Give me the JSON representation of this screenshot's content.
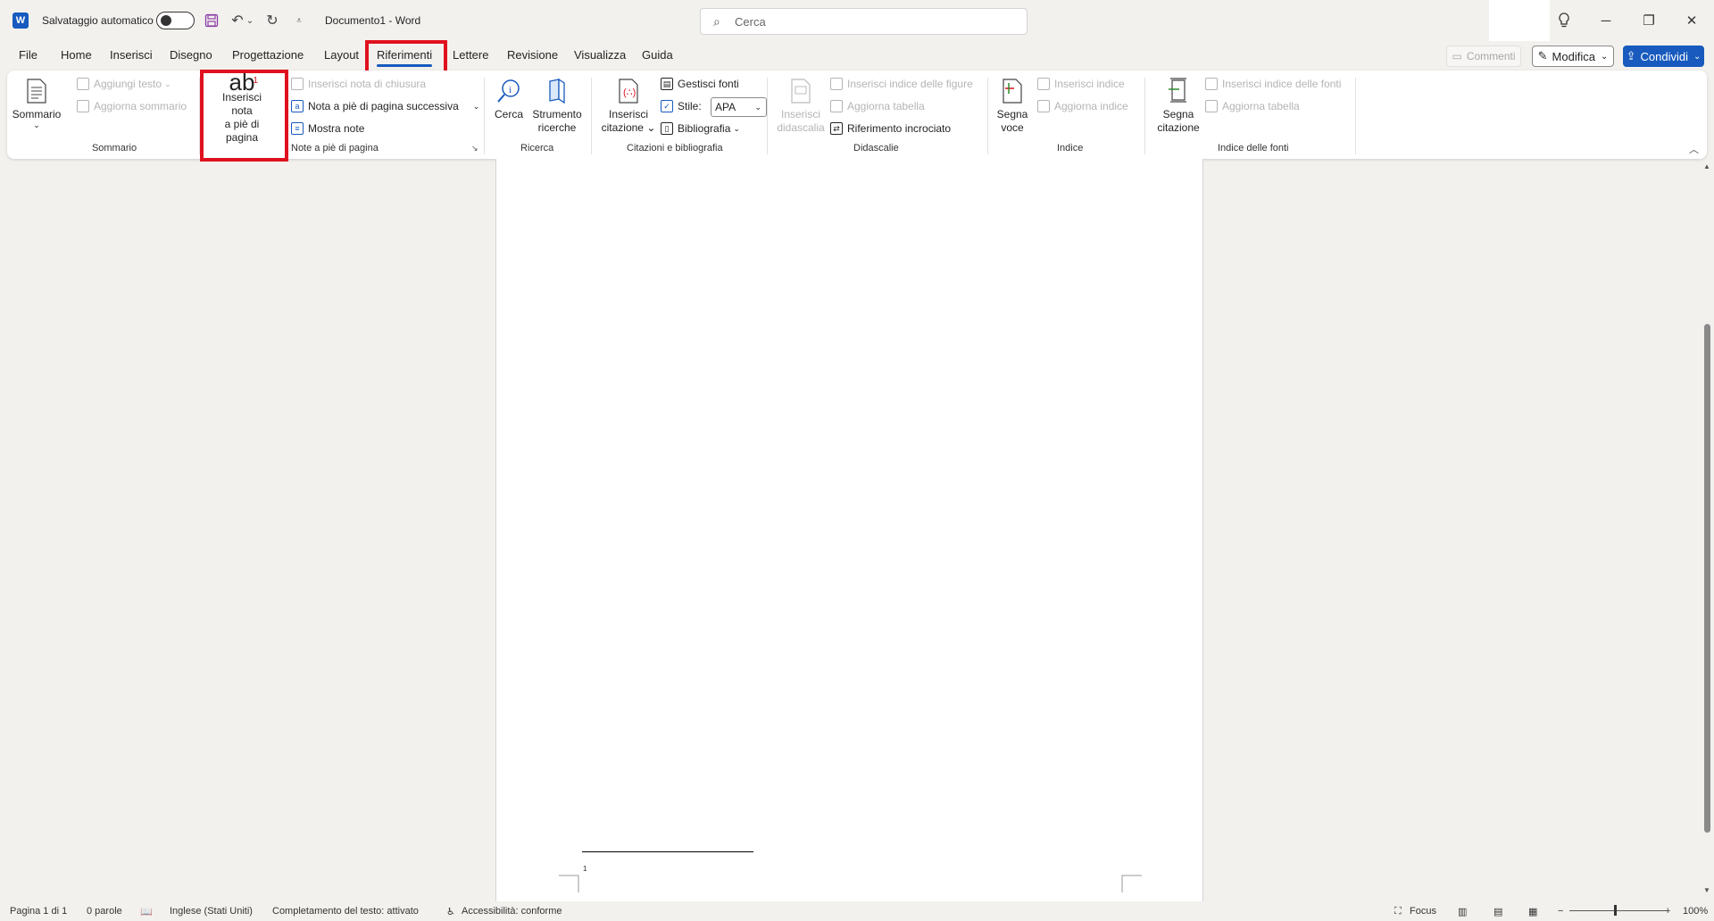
{
  "titlebar": {
    "autosave_label": "Salvataggio automatico",
    "doc_title": "Documento1 - Word",
    "search_placeholder": "Cerca"
  },
  "tabs": [
    "File",
    "Home",
    "Inserisci",
    "Disegno",
    "Progettazione",
    "Layout",
    "Riferimenti",
    "Lettere",
    "Revisione",
    "Visualizza",
    "Guida"
  ],
  "active_tab": "Riferimenti",
  "header_buttons": {
    "comments": "Commenti",
    "edit": "Modifica",
    "share": "Condividi"
  },
  "ribbon": {
    "sommario": {
      "big_label": "Sommario",
      "add_text": "Aggiungi testo",
      "update": "Aggiorna sommario",
      "group": "Sommario"
    },
    "footnotes": {
      "insert_line1": "Inserisci nota",
      "insert_line2": "a piè di pagina",
      "insert_endnote": "Inserisci nota di chiusura",
      "next_footnote": "Nota a piè di pagina successiva",
      "show_notes": "Mostra note",
      "group": "Note a piè di pagina"
    },
    "ricerca": {
      "cerca": "Cerca",
      "researcher_line1": "Strumento",
      "researcher_line2": "ricerche",
      "group": "Ricerca"
    },
    "citations": {
      "insert_line1": "Inserisci",
      "insert_line2": "citazione",
      "manage_sources": "Gestisci fonti",
      "style_label": "Stile:",
      "style_value": "APA",
      "bibliography": "Bibliografia",
      "group": "Citazioni e bibliografia"
    },
    "captions": {
      "insert_line1": "Inserisci",
      "insert_line2": "didascalia",
      "table_of_figures": "Inserisci indice delle figure",
      "update_table": "Aggiorna tabella",
      "cross_ref": "Riferimento incrociato",
      "group": "Didascalie"
    },
    "index": {
      "mark_line1": "Segna",
      "mark_line2": "voce",
      "insert_index": "Inserisci indice",
      "update_index": "Aggiorna indice",
      "group": "Indice"
    },
    "authorities": {
      "mark_line1": "Segna",
      "mark_line2": "citazione",
      "insert_table": "Inserisci indice delle fonti",
      "update_table": "Aggiorna tabella",
      "group": "Indice delle fonti"
    }
  },
  "document": {
    "footnote_number": "1"
  },
  "statusbar": {
    "page": "Pagina 1 di 1",
    "words": "0 parole",
    "language": "Inglese (Stati Uniti)",
    "text_prediction": "Completamento del testo: attivato",
    "accessibility": "Accessibilità: conforme",
    "focus": "Focus",
    "zoom": "100%",
    "zoom_fraction": 0.5
  },
  "colors": {
    "accent": "#185abd",
    "highlight": "#e0111e"
  }
}
